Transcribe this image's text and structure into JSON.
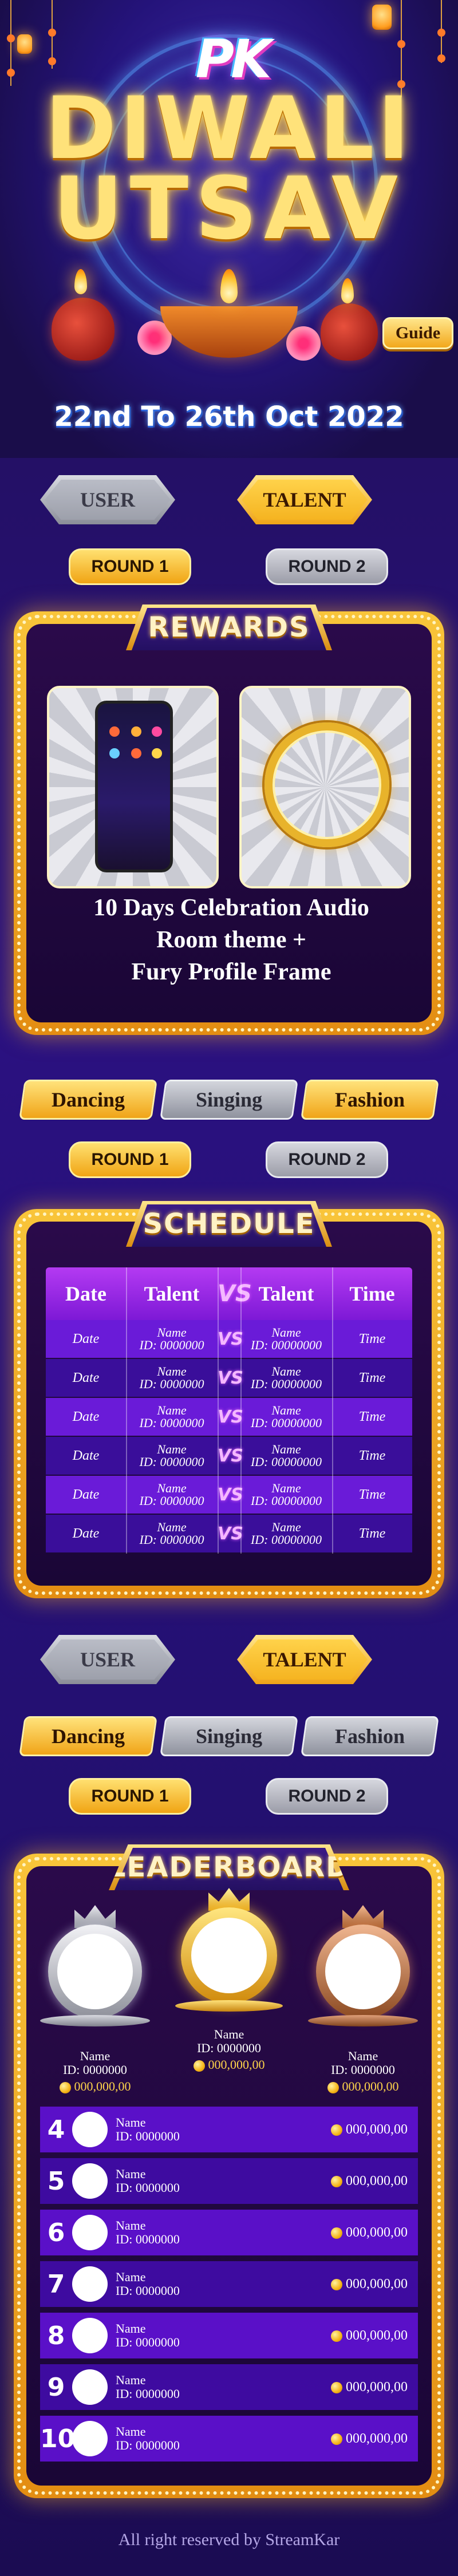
{
  "hero": {
    "logo": "PK",
    "title_line1": "DIWALI",
    "title_line2": "UTSAV",
    "date_text": "22nd To 26th Oct 2022",
    "guide_label": "Guide"
  },
  "role_tabs": {
    "user": "USER",
    "talent": "TALENT",
    "active": "talent"
  },
  "rounds": {
    "round1": "ROUND 1",
    "round2": "ROUND 2",
    "active": "round1"
  },
  "rewards": {
    "title": "REWARDS",
    "description_line1": "10 Days Celebration Audio",
    "description_line2": "Room theme +",
    "description_line3": "Fury Profile Frame"
  },
  "categories": {
    "dancing": "Dancing",
    "singing": "Singing",
    "fashion": "Fashion",
    "active_schedule": "fashion",
    "active_leaderboard": "dancing"
  },
  "schedule": {
    "title": "SCHEDULE",
    "headers": {
      "date": "Date",
      "talent_a": "Talent",
      "vs": "VS",
      "talent_b": "Talent",
      "time": "Time"
    },
    "rows": [
      {
        "date": "Date",
        "a_name": "Name",
        "a_id": "ID: 0000000",
        "b_name": "Name",
        "b_id": "ID: 00000000",
        "time": "Time"
      },
      {
        "date": "Date",
        "a_name": "Name",
        "a_id": "ID: 0000000",
        "b_name": "Name",
        "b_id": "ID: 00000000",
        "time": "Time"
      },
      {
        "date": "Date",
        "a_name": "Name",
        "a_id": "ID: 0000000",
        "b_name": "Name",
        "b_id": "ID: 00000000",
        "time": "Time"
      },
      {
        "date": "Date",
        "a_name": "Name",
        "a_id": "ID: 0000000",
        "b_name": "Name",
        "b_id": "ID: 00000000",
        "time": "Time"
      },
      {
        "date": "Date",
        "a_name": "Name",
        "a_id": "ID: 0000000",
        "b_name": "Name",
        "b_id": "ID: 00000000",
        "time": "Time"
      },
      {
        "date": "Date",
        "a_name": "Name",
        "a_id": "ID: 0000000",
        "b_name": "Name",
        "b_id": "ID: 00000000",
        "time": "Time"
      }
    ]
  },
  "leaderboard": {
    "title": "LEADERBOARD",
    "top3": [
      {
        "rank": 2,
        "name": "Name",
        "id": "ID: 0000000",
        "score": "000,000,00"
      },
      {
        "rank": 1,
        "name": "Name",
        "id": "ID: 0000000",
        "score": "000,000,00"
      },
      {
        "rank": 3,
        "name": "Name",
        "id": "ID: 0000000",
        "score": "000,000,00"
      }
    ],
    "rows": [
      {
        "rank": "4",
        "name": "Name",
        "id": "ID: 0000000",
        "score": "000,000,00"
      },
      {
        "rank": "5",
        "name": "Name",
        "id": "ID: 0000000",
        "score": "000,000,00"
      },
      {
        "rank": "6",
        "name": "Name",
        "id": "ID: 0000000",
        "score": "000,000,00"
      },
      {
        "rank": "7",
        "name": "Name",
        "id": "ID: 0000000",
        "score": "000,000,00"
      },
      {
        "rank": "8",
        "name": "Name",
        "id": "ID: 0000000",
        "score": "000,000,00"
      },
      {
        "rank": "9",
        "name": "Name",
        "id": "ID: 0000000",
        "score": "000,000,00"
      },
      {
        "rank": "10",
        "name": "Name",
        "id": "ID: 0000000",
        "score": "000,000,00"
      }
    ]
  },
  "footer": "All right reserved by StreamKar",
  "colors": {
    "gold": "#f5b421",
    "purple": "#241066",
    "schedule_header": "#b43af2"
  }
}
